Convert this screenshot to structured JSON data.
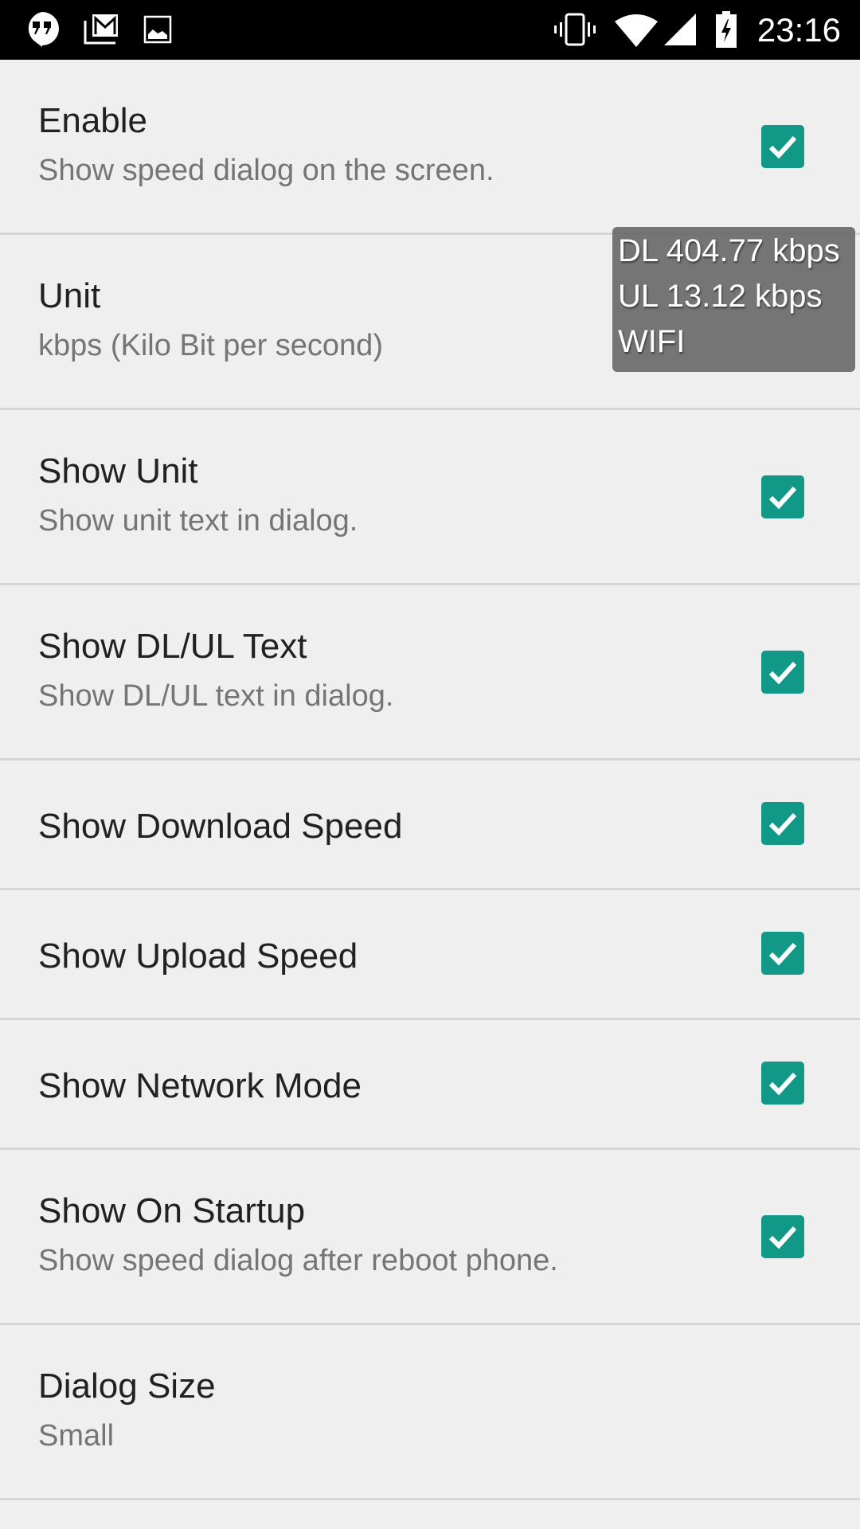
{
  "status_bar": {
    "left_icons": [
      "hangouts-icon",
      "gmail-icon",
      "gallery-icon"
    ],
    "right_icons": [
      "vibrate-icon",
      "wifi-icon",
      "cell-signal-icon",
      "battery-charging-icon"
    ],
    "time": "23:16"
  },
  "settings": [
    {
      "title": "Enable",
      "summary": "Show speed dialog on the screen.",
      "checked": true
    },
    {
      "title": "Unit",
      "summary": "kbps (Kilo Bit per second)"
    },
    {
      "title": "Show Unit",
      "summary": "Show unit text in dialog.",
      "checked": true
    },
    {
      "title": "Show DL/UL Text",
      "summary": "Show DL/UL text in dialog.",
      "checked": true
    },
    {
      "title": "Show Download Speed",
      "checked": true
    },
    {
      "title": "Show Upload Speed",
      "checked": true
    },
    {
      "title": "Show Network Mode",
      "checked": true
    },
    {
      "title": "Show On Startup",
      "summary": "Show speed dialog after reboot phone.",
      "checked": true
    },
    {
      "title": "Dialog Size",
      "summary": "Small"
    }
  ],
  "speed_overlay": {
    "download": "DL 404.77 kbps",
    "upload": "UL 13.12 kbps",
    "network": "WIFI"
  },
  "colors": {
    "accent": "#129887",
    "background": "#efefef",
    "statusbar": "#000000"
  }
}
